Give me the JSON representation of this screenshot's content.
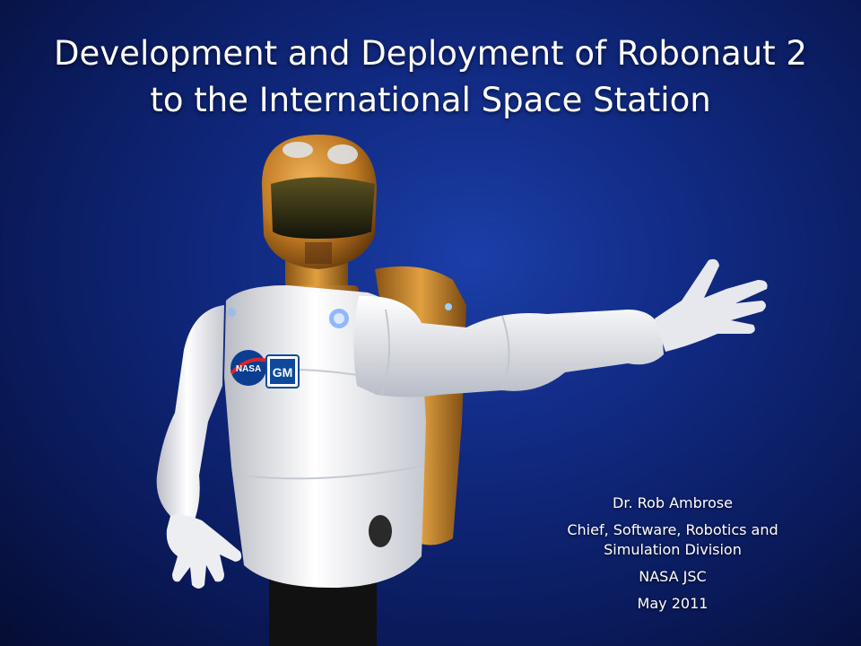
{
  "slide": {
    "title_line1": "Development and Deployment of Robonaut 2",
    "title_line2": "to the International Space Station",
    "presenter": {
      "name": "Dr. Rob Ambrose",
      "role_line1": "Chief, Software, Robotics and",
      "role_line2": "Simulation Division",
      "org": "NASA JSC",
      "date": "May 2011"
    },
    "logos": {
      "nasa": "NASA",
      "gm": "GM"
    }
  },
  "colors": {
    "background": "#10287e",
    "robot_body": "#f2f2f2",
    "robot_gold": "#c88a2a",
    "visor": "#2a2a1a",
    "gm_blue": "#0e4a9c",
    "nasa_blue": "#0b3d91"
  }
}
